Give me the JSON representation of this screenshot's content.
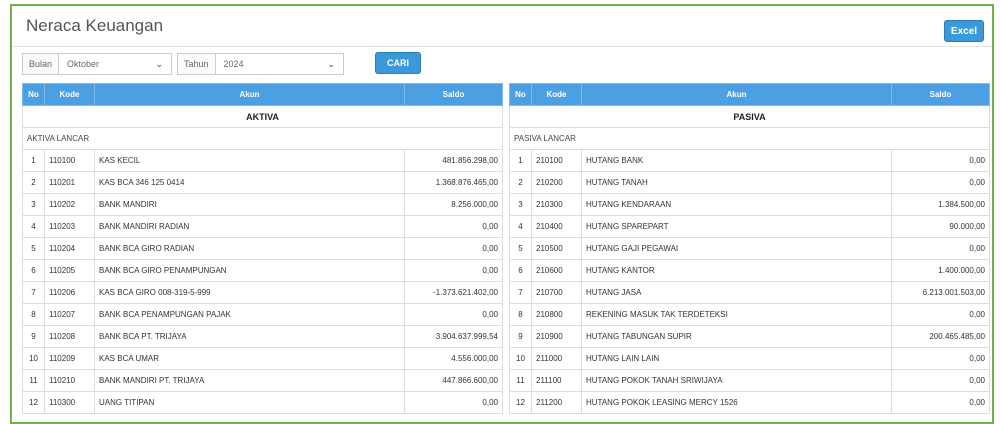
{
  "page": {
    "title": "Neraca Keuangan",
    "excel_label": "Excel"
  },
  "filters": {
    "bulan_label": "Bulan",
    "bulan_value": "Oktober",
    "tahun_label": "Tahun",
    "tahun_value": "2024",
    "search_label": "CARI"
  },
  "columns": {
    "no": "No",
    "kode": "Kode",
    "akun": "Akun",
    "saldo": "Saldo"
  },
  "aktiva": {
    "title": "AKTIVA",
    "group": "AKTIVA LANCAR",
    "rows": [
      {
        "no": "1",
        "kode": "110100",
        "akun": "KAS KECIL",
        "saldo": "481.856.298,00"
      },
      {
        "no": "2",
        "kode": "110201",
        "akun": "KAS BCA 346 125 0414",
        "saldo": "1.368.876.465,00"
      },
      {
        "no": "3",
        "kode": "110202",
        "akun": "BANK MANDIRI",
        "saldo": "8.256.000,00"
      },
      {
        "no": "4",
        "kode": "110203",
        "akun": "BANK MANDIRI RADIAN",
        "saldo": "0,00"
      },
      {
        "no": "5",
        "kode": "110204",
        "akun": "BANK BCA GIRO RADIAN",
        "saldo": "0,00"
      },
      {
        "no": "6",
        "kode": "110205",
        "akun": "BANK BCA GIRO PENAMPUNGAN",
        "saldo": "0,00"
      },
      {
        "no": "7",
        "kode": "110206",
        "akun": "KAS BCA GIRO 008-319-5-999",
        "saldo": "-1.373.621.402,00"
      },
      {
        "no": "8",
        "kode": "110207",
        "akun": "BANK BCA PENAMPUNGAN PAJAK",
        "saldo": "0,00"
      },
      {
        "no": "9",
        "kode": "110208",
        "akun": "BANK BCA PT. TRIJAYA",
        "saldo": "3.904.637.999,54"
      },
      {
        "no": "10",
        "kode": "110209",
        "akun": "KAS BCA UMAR",
        "saldo": "4.556.000,00"
      },
      {
        "no": "11",
        "kode": "110210",
        "akun": "BANK MANDIRI PT. TRIJAYA",
        "saldo": "447.866.600,00"
      },
      {
        "no": "12",
        "kode": "110300",
        "akun": "UANG TITIPAN",
        "saldo": "0,00"
      }
    ]
  },
  "pasiva": {
    "title": "PASIVA",
    "group": "PASIVA LANCAR",
    "rows": [
      {
        "no": "1",
        "kode": "210100",
        "akun": "HUTANG BANK",
        "saldo": "0,00"
      },
      {
        "no": "2",
        "kode": "210200",
        "akun": "HUTANG TANAH",
        "saldo": "0,00"
      },
      {
        "no": "3",
        "kode": "210300",
        "akun": "HUTANG KENDARAAN",
        "saldo": "1.384.500,00"
      },
      {
        "no": "4",
        "kode": "210400",
        "akun": "HUTANG SPAREPART",
        "saldo": "90.000,00"
      },
      {
        "no": "5",
        "kode": "210500",
        "akun": "HUTANG GAJI PEGAWAI",
        "saldo": "0,00"
      },
      {
        "no": "6",
        "kode": "210600",
        "akun": "HUTANG KANTOR",
        "saldo": "1.400.000,00"
      },
      {
        "no": "7",
        "kode": "210700",
        "akun": "HUTANG JASA",
        "saldo": "6.213.001.503,00"
      },
      {
        "no": "8",
        "kode": "210800",
        "akun": "REKENING MASUK TAK TERDETEKSI",
        "saldo": "0,00"
      },
      {
        "no": "9",
        "kode": "210900",
        "akun": "HUTANG TABUNGAN SUPIR",
        "saldo": "200.465.485,00"
      },
      {
        "no": "10",
        "kode": "211000",
        "akun": "HUTANG LAIN LAIN",
        "saldo": "0,00"
      },
      {
        "no": "11",
        "kode": "211100",
        "akun": "HUTANG POKOK TANAH SRIWIJAYA",
        "saldo": "0,00"
      },
      {
        "no": "12",
        "kode": "211200",
        "akun": "HUTANG POKOK LEASING MERCY 1526",
        "saldo": "0,00"
      }
    ]
  },
  "colors": {
    "accent": "#3a9ad9",
    "header_bg": "#4d9fe3",
    "frame_border": "#6fb34a"
  }
}
